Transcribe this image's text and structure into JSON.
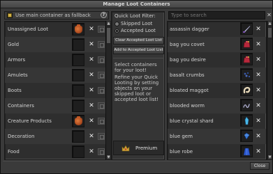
{
  "window": {
    "title": "Manage Loot Containers"
  },
  "left": {
    "fallback_label": "Use main container as fallback",
    "info_icon": "?",
    "categories": [
      {
        "name": "Unassigned Loot",
        "icon": "bag-icon"
      },
      {
        "name": "Gold",
        "icon": ""
      },
      {
        "name": "Armors",
        "icon": ""
      },
      {
        "name": "Amulets",
        "icon": ""
      },
      {
        "name": "Boots",
        "icon": ""
      },
      {
        "name": "Containers",
        "icon": ""
      },
      {
        "name": "Creature Products",
        "icon": "bag-icon"
      },
      {
        "name": "Decoration",
        "icon": ""
      },
      {
        "name": "Food",
        "icon": ""
      }
    ]
  },
  "filter": {
    "title": "Quick Loot Filter:",
    "options": [
      "Skipped Loot",
      "Accepted Loot"
    ],
    "selected": "Accepted Loot",
    "clear_button": "Clear Accepted Loot List",
    "add_button": "Add to Accepted Loot List",
    "select_text": "Select containers for your loot!",
    "refine_text": "Refine your Quick Looting by setting objects on your skipped loot or accepted loot list!",
    "premium_label": "Premium"
  },
  "right": {
    "search_placeholder": "Type to search",
    "items": [
      {
        "name": "assassin dagger",
        "icon": "dagger-icon"
      },
      {
        "name": "bag you covet",
        "icon": "bag-icon"
      },
      {
        "name": "bag you desire",
        "icon": "bag-icon"
      },
      {
        "name": "basalt crumbs",
        "icon": "crumbs-icon"
      },
      {
        "name": "bloated maggot",
        "icon": "maggot-icon"
      },
      {
        "name": "blooded worm",
        "icon": "worm-icon"
      },
      {
        "name": "blue crystal shard",
        "icon": "crystal-icon"
      },
      {
        "name": "blue gem",
        "icon": "gem-icon"
      },
      {
        "name": "blue robe",
        "icon": "robe-icon"
      }
    ]
  },
  "footer": {
    "close_label": "Close"
  },
  "colors": {
    "accent": "#d2b046",
    "window_bg": "#3a3a3a",
    "panel_bg": "#2e2e2e",
    "text": "#d4d4d4"
  }
}
